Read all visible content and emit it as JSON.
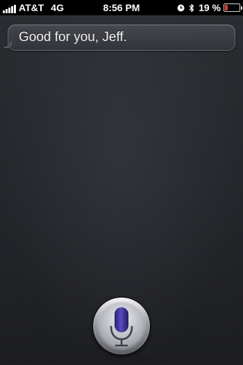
{
  "status_bar": {
    "carrier": "AT&T",
    "network": "4G",
    "time": "8:56 PM",
    "battery_percent": "19 %",
    "battery_level": 0.19,
    "battery_color": "#e23a2f",
    "icons": [
      "signal-bars-icon",
      "clock-icon",
      "bluetooth-icon",
      "battery-icon"
    ]
  },
  "siri": {
    "response_text": "Good for you, Jeff.",
    "mic_icon": "microphone-icon",
    "accent_color": "#4a3aa8"
  }
}
